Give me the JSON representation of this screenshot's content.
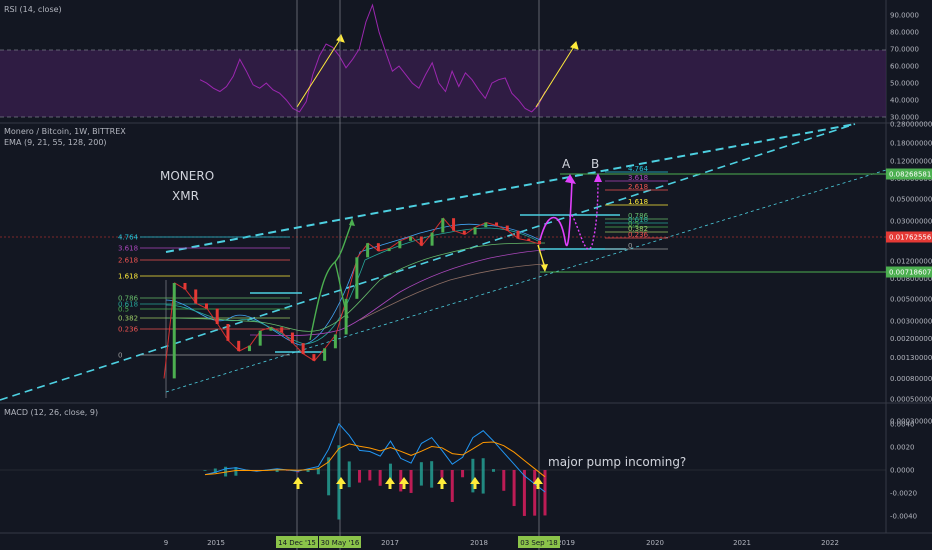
{
  "panels": {
    "rsi_title": "RSI (14, close)",
    "price_title": "Monero / Bitcoin, 1W, BITTREX",
    "ema_title": "EMA (9, 21, 55, 128, 200)",
    "macd_title": "MACD (12, 26, close, 9)"
  },
  "annotations": {
    "coin_name": "MONERO",
    "coin_ticker": "XMR",
    "scenario_a": "A",
    "scenario_b": "B",
    "comment": "major pump incoming?"
  },
  "price_tags": [
    {
      "label": "0.08268581",
      "color": "#4caf50"
    },
    {
      "label": "0.01762556",
      "color": "#e53935"
    },
    {
      "label": "0.00718607",
      "color": "#4caf50"
    }
  ],
  "fib_left": [
    "4.764",
    "3.618",
    "2.618",
    "1.618",
    "0.786",
    "0.618",
    "0.5",
    "0.382",
    "0.236",
    "0"
  ],
  "fib_right": [
    "4.764",
    "3.618",
    "2.618",
    "1.618",
    "0.786",
    "0.618",
    "0.5",
    "0.382",
    "0.236",
    "0"
  ],
  "time_axis": {
    "labels": [
      "9",
      "2015",
      "2017",
      "2018",
      "2019",
      "2020",
      "2021",
      "2022"
    ],
    "highlights": [
      "14 Dec '15",
      "30 May '16",
      "03 Sep '18"
    ]
  },
  "colors": {
    "background": "#131722",
    "rsi_line": "#9c27b0",
    "rsi_band": "#3a1f4f",
    "trend_dashed": "#4dd0e1",
    "green": "#4caf50",
    "red": "#e53935",
    "magenta": "#e040fb",
    "yellow": "#ffeb3b"
  },
  "chart_data": [
    {
      "type": "line",
      "title": "RSI (14, close)",
      "y_axis_labels": [
        "90.0000",
        "80.0000",
        "70.0000",
        "60.0000",
        "50.0000",
        "40.0000",
        "30.0000"
      ],
      "ylim": [
        30,
        96
      ],
      "bands": [
        30,
        70
      ],
      "series": [
        {
          "values": [
            52,
            50,
            47,
            45,
            48,
            54,
            64,
            57,
            49,
            47,
            50,
            46,
            44,
            40,
            35,
            33,
            39,
            55,
            66,
            73,
            71,
            66,
            59,
            64,
            70,
            86,
            96,
            80,
            68,
            57,
            60,
            55,
            50,
            47,
            55,
            62,
            50,
            45,
            57,
            48,
            56,
            52,
            46,
            41,
            50,
            52,
            53,
            44,
            40,
            35,
            33,
            37,
            45
          ]
        }
      ]
    },
    {
      "type": "line",
      "title": "Monero / Bitcoin, 1W, BITTREX",
      "y_axis_labels": [
        "0.28000000",
        "0.18000000",
        "0.12000000",
        "0.08000000",
        "0.05000000",
        "0.03000000",
        "0.02000000",
        "0.01200000",
        "0.00800000",
        "0.00500000",
        "0.00300000",
        "0.00200000",
        "0.00130000",
        "0.00080000",
        "0.00050000",
        "0.00030000"
      ],
      "log_scale": true,
      "series": [
        {
          "values": [
            0.0008,
            0.0072,
            0.0062,
            0.0045,
            0.004,
            0.0028,
            0.0019,
            0.0015,
            0.0017,
            0.0024,
            0.0026,
            0.0023,
            0.0018,
            0.0014,
            0.0012,
            0.0016,
            0.0022,
            0.005,
            0.013,
            0.018,
            0.015,
            0.016,
            0.019,
            0.021,
            0.017,
            0.023,
            0.032,
            0.024,
            0.022,
            0.026,
            0.029,
            0.027,
            0.024,
            0.02,
            0.019,
            0.0176
          ]
        }
      ]
    },
    {
      "type": "line",
      "title": "MACD (12, 26, close, 9)",
      "y_axis_labels": [
        "0.0040",
        "0.0020",
        "0.0000",
        "-0.0020",
        "-0.0040"
      ],
      "ylim": [
        -0.0045,
        0.0045
      ],
      "series": [
        {
          "values": [
            -0.0004,
            -0.0002,
            0.0001,
            0.0002,
            0.0,
            -0.0001,
            0.0,
            0.0001,
            0.0,
            -0.0001,
            0.0001,
            0.0003,
            0.0018,
            0.004,
            0.003,
            0.0017,
            0.0016,
            0.0012,
            0.0025,
            0.001,
            0.0006,
            0.0023,
            0.0028,
            0.0017,
            0.0005,
            0.0011,
            0.0028,
            0.0034,
            0.0025,
            0.0015,
            0.0005,
            -0.0005,
            -0.0012,
            -0.0019
          ]
        }
      ]
    }
  ]
}
